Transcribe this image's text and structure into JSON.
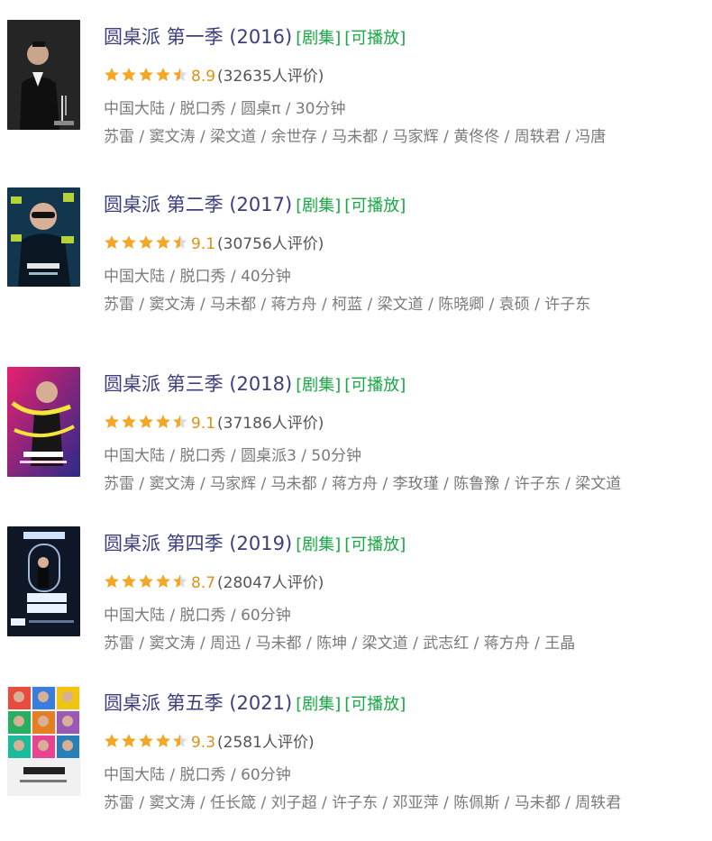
{
  "items": [
    {
      "title": "圆桌派 第一季 (2016)",
      "tag_type": "[剧集]",
      "tag_play": "[可播放]",
      "rating": 4.5,
      "score": "8.9",
      "votes": "(32635人评价)",
      "meta": "中国大陆 / 脱口秀 / 圆桌π / 30分钟",
      "cast": "苏雷 / 窦文涛 / 梁文道 / 余世存 / 马未都 / 马家辉 / 黄佟佟 / 周轶君 / 冯唐",
      "poster": {
        "bg": "#1c1c1c",
        "accent": "#e6e6e6",
        "text": "窦文涛"
      }
    },
    {
      "title": "圆桌派 第二季 (2017)",
      "tag_type": "[剧集]",
      "tag_play": "[可播放]",
      "rating": 4.5,
      "score": "9.1",
      "votes": "(30756人评价)",
      "meta": "中国大陆 / 脱口秀 / 40分钟",
      "cast": "苏雷 / 窦文涛 / 马未都 / 蒋方舟 / 柯蓝 / 梁文道 / 陈晓卿 / 袁硕 / 许子东",
      "poster": {
        "bg": "#0e2a3c",
        "accent": "#b7d33a",
        "text": "圆桌派"
      }
    },
    {
      "title": "圆桌派 第三季 (2018)",
      "tag_type": "[剧集]",
      "tag_play": "[可播放]",
      "rating": 4.5,
      "score": "9.1",
      "votes": "(37186人评价)",
      "meta": "中国大陆 / 脱口秀 / 圆桌派3 / 50分钟",
      "cast": "苏雷 / 窦文涛 / 马家辉 / 马未都 / 蒋方舟 / 李玫瑾 / 陈鲁豫 / 许子东 / 梁文道",
      "poster": {
        "bg": "#e0206e",
        "accent": "#f7e43a",
        "text": "圆桌派"
      }
    },
    {
      "title": "圆桌派 第四季 (2019)",
      "tag_type": "[剧集]",
      "tag_play": "[可播放]",
      "rating": 4.5,
      "score": "8.7",
      "votes": "(28047人评价)",
      "meta": "中国大陆 / 脱口秀 / 60分钟",
      "cast": "苏雷 / 窦文涛 / 周迅 / 马未都 / 陈坤 / 梁文道 / 武志红 / 蒋方舟 / 王晶",
      "poster": {
        "bg": "#101827",
        "accent": "#cfe3ff",
        "text": "圆桌派"
      }
    },
    {
      "title": "圆桌派 第五季 (2021)",
      "tag_type": "[剧集]",
      "tag_play": "[可播放]",
      "rating": 4.5,
      "score": "9.3",
      "votes": "(2581人评价)",
      "meta": "中国大陆 / 脱口秀 / 60分钟",
      "cast": "苏雷 / 窦文涛 / 任长箴 / 刘子超 / 许子东 / 邓亚萍 / 陈佩斯 / 马未都 / 周轶君",
      "poster": {
        "bg": "#efefef",
        "accent": "#222222",
        "text": "圆桌派"
      }
    }
  ],
  "colors": {
    "title": "#3d3f7d",
    "tag": "#18a844",
    "star": "#f5a623",
    "score": "#e09015",
    "meta": "#7a7a7a"
  }
}
